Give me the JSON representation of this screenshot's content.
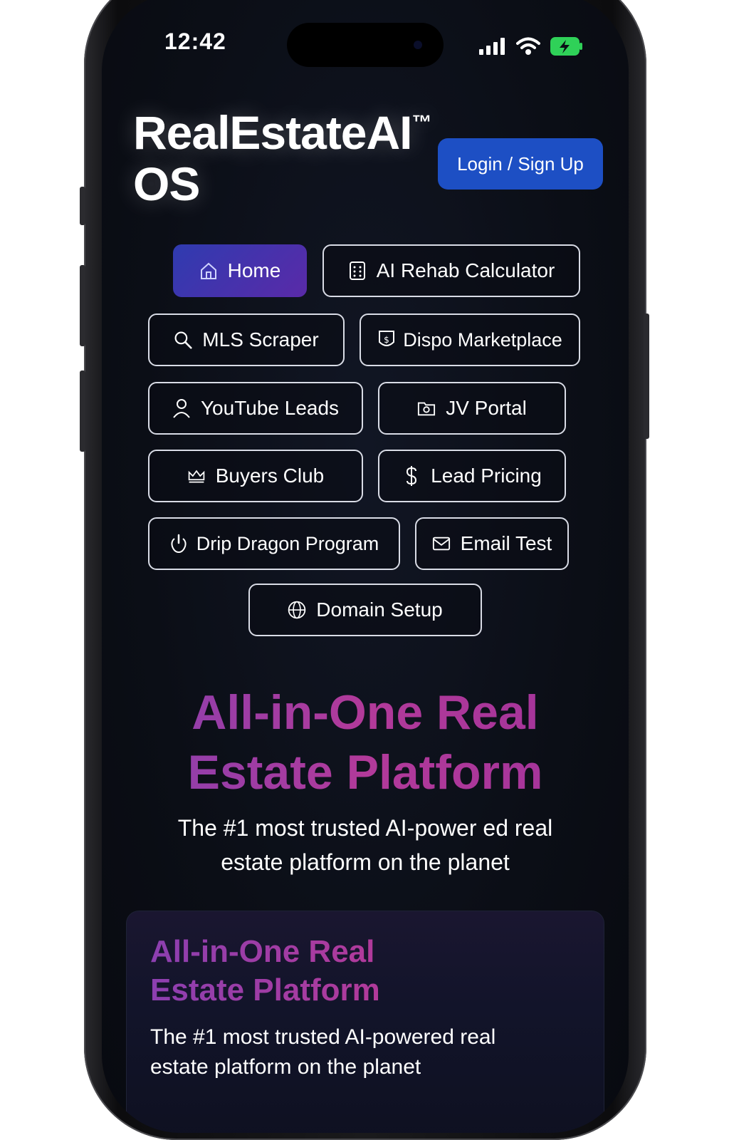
{
  "status_bar": {
    "time": "12:42",
    "icons": [
      "signal-icon",
      "wifi-icon",
      "battery-charging-icon"
    ]
  },
  "header": {
    "brand_line1": "RealEstateAI",
    "brand_tm": "™",
    "brand_line2": "OS",
    "login_label": "Login / Sign Up"
  },
  "nav": {
    "home": "Home",
    "ai_rehab": "AI Rehab Calculator",
    "mls_scraper": "MLS Scraper",
    "dispo": "Dispo Marketplace",
    "youtube_leads": "YouTube Leads",
    "jv_portal": "JV Portal",
    "buyers_club": "Buyers Club",
    "lead_pricing": "Lead Pricing",
    "drip_dragon": "Drip Dragon Program",
    "email_test": "Email Test",
    "domain_setup": "Domain Setup"
  },
  "hero": {
    "title_line1": "All-in-One Real",
    "title_line2": "Estate Platform",
    "subtitle_line1": "The #1 most trusted AI-power ed real",
    "subtitle_line2": "estate platform on the planet"
  },
  "card": {
    "title_line1": "All-in-One Real",
    "title_line2": "Estate Platform",
    "subtitle_line1": "The #1 most trusted AI-powered real",
    "subtitle_line2": "estate platform on the planet"
  },
  "colors": {
    "background": "#0b0e16",
    "accent_blue": "#1d4fc4",
    "accent_purple": "#5a2aa8",
    "heading_magenta": "#b23a9a"
  }
}
